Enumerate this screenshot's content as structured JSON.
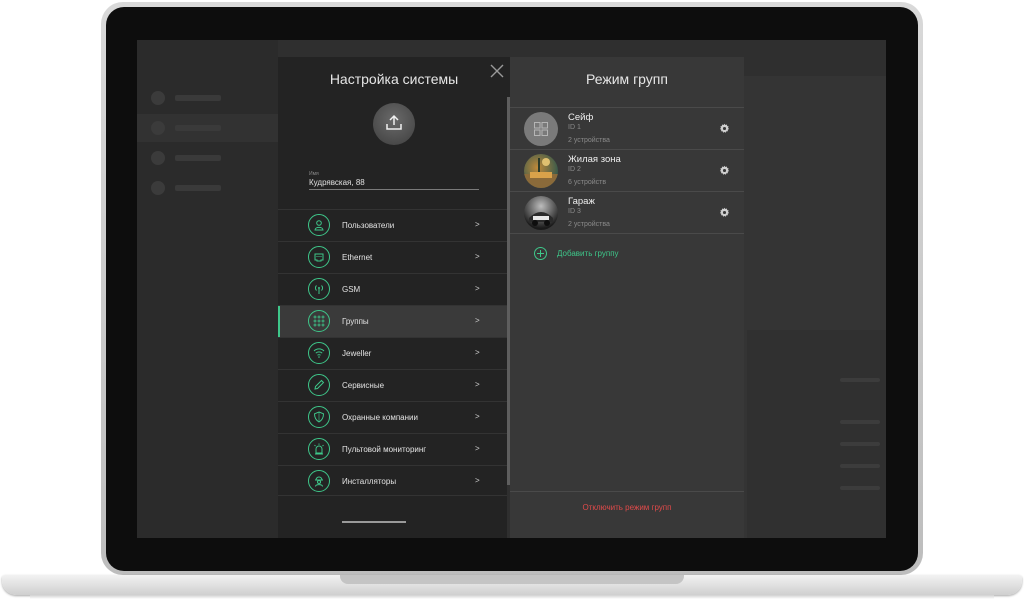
{
  "settings": {
    "title": "Настройка системы",
    "name_label": "Имя",
    "name_value": "Кудрявская, 88",
    "menu": [
      {
        "label": "Пользователи",
        "arrow": ">",
        "icon": "user-icon"
      },
      {
        "label": "Ethernet",
        "arrow": ">",
        "icon": "ethernet-icon"
      },
      {
        "label": "GSM",
        "arrow": ">",
        "icon": "antenna-icon"
      },
      {
        "label": "Группы",
        "arrow": ">",
        "icon": "groups-dots-icon",
        "active": true
      },
      {
        "label": "Jeweller",
        "arrow": ">",
        "icon": "wifi-icon"
      },
      {
        "label": "Сервисные",
        "arrow": ">",
        "icon": "pencil-icon"
      },
      {
        "label": "Охранные компании",
        "arrow": ">",
        "icon": "shield-icon"
      },
      {
        "label": "Пультовой мониторинг",
        "arrow": ">",
        "icon": "siren-icon"
      },
      {
        "label": "Инсталляторы",
        "arrow": ">",
        "icon": "installer-icon"
      }
    ]
  },
  "groups": {
    "title": "Режим групп",
    "items": [
      {
        "name": "Сейф",
        "id": "ID 1",
        "devices": "2 устройства"
      },
      {
        "name": "Жилая зона",
        "id": "ID 2",
        "devices": "6 устройств"
      },
      {
        "name": "Гараж",
        "id": "ID 3",
        "devices": "2 устройства"
      }
    ],
    "add_label": "Добавить группу",
    "disable_label": "Отключить режим групп"
  },
  "colors": {
    "accent": "#3ec78a",
    "danger": "#e04a4a",
    "panel_dark": "#232323",
    "panel_mid": "#383838"
  }
}
